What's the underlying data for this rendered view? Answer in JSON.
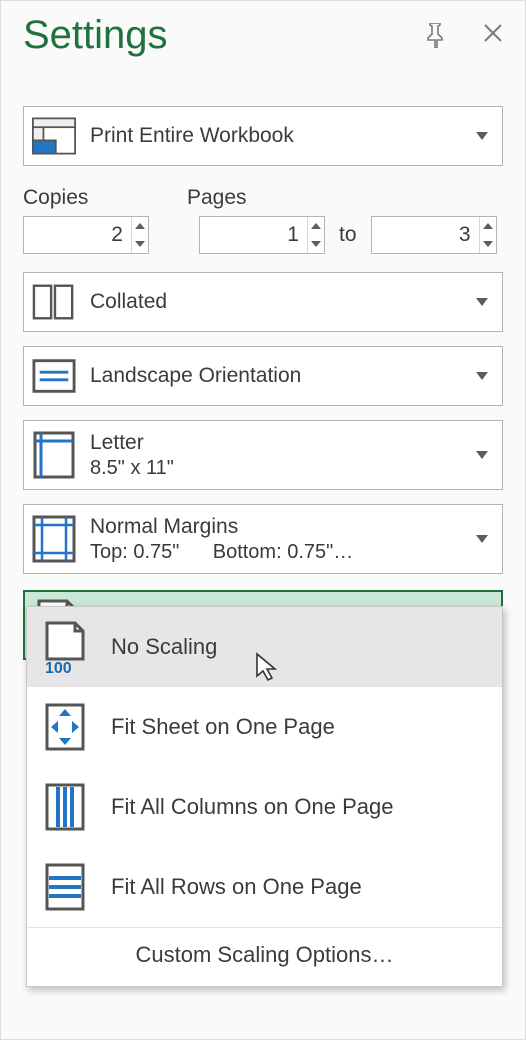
{
  "title": "Settings",
  "print_what": {
    "label": "Print Entire Workbook"
  },
  "copies": {
    "label": "Copies",
    "value": "2"
  },
  "pages": {
    "label": "Pages",
    "from": "1",
    "to_label": "to",
    "to": "3"
  },
  "collate": {
    "label": "Collated"
  },
  "orientation": {
    "label": "Landscape Orientation"
  },
  "paper": {
    "title": "Letter",
    "sub": "8.5\" x 11\""
  },
  "margins": {
    "title": "Normal Margins",
    "sub": "Top: 0.75\"      Bottom: 0.75\"…"
  },
  "scaling": {
    "label": "No Scaling"
  },
  "scaling_menu": {
    "items": [
      {
        "label": "No Scaling"
      },
      {
        "label": "Fit Sheet on One Page"
      },
      {
        "label": "Fit All Columns on One Page"
      },
      {
        "label": "Fit All Rows on One Page"
      }
    ],
    "footer": "Custom Scaling Options…"
  }
}
